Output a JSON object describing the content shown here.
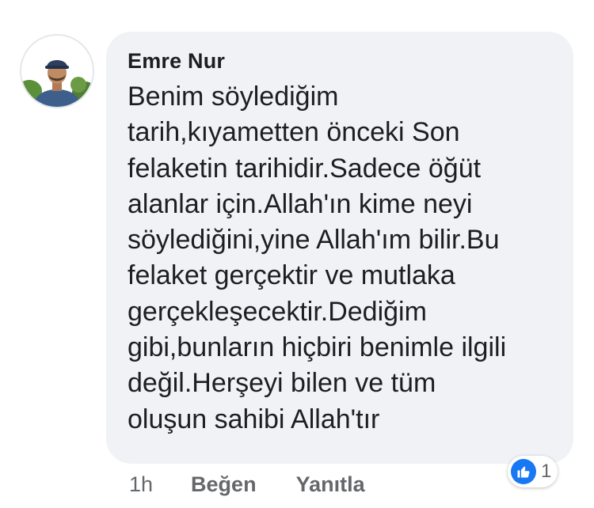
{
  "comment": {
    "author": "Emre Nur",
    "text_lines": [
      "Benim söylediğim",
      "tarih,kıyametten önceki Son",
      "felaketin tarihidir.Sadece öğüt",
      "alanlar için.Allah'ın kime neyi",
      "söylediğini,yine Allah'ım bilir.Bu",
      "felaket gerçektir ve mutlaka",
      "gerçekleşecektir.Dediğim",
      "gibi,bunların hiçbiri benimle ilgili",
      "değil.Herşeyi bilen ve tüm",
      "oluşun sahibi Allah'tır"
    ],
    "time": "1h",
    "like_label": "Beğen",
    "reply_label": "Yanıtla",
    "reaction_count": "1",
    "reaction_icon": "thumbs-up-icon"
  },
  "colors": {
    "bubble_bg": "#f0f2f5",
    "text": "#1c1e21",
    "meta": "#65676b",
    "like_blue": "#1877f2"
  }
}
